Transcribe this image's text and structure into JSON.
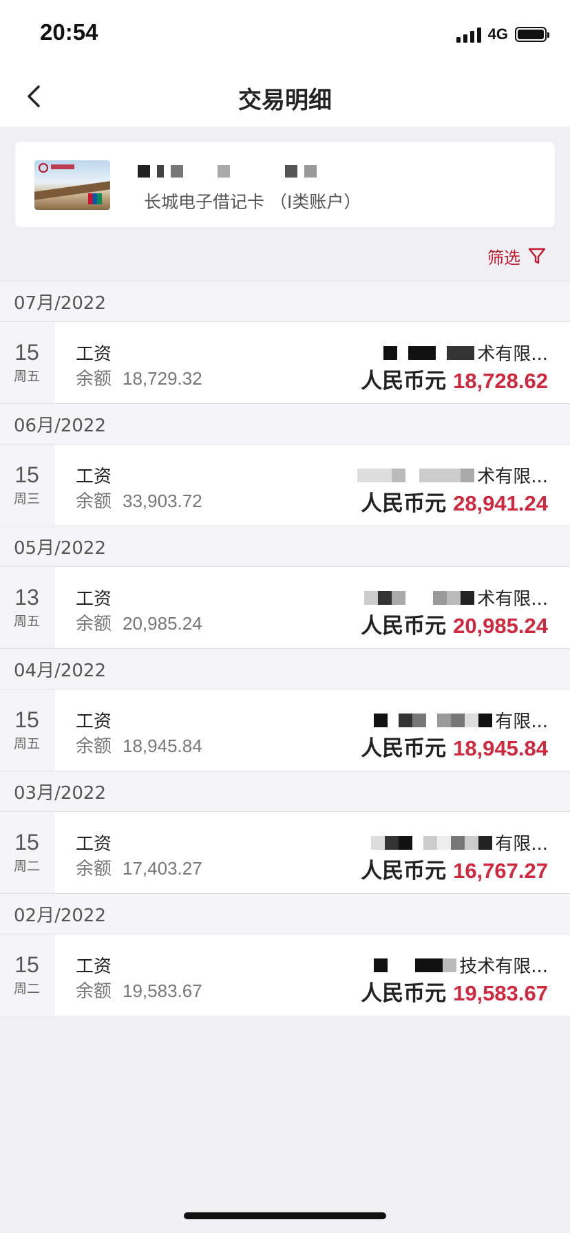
{
  "status_bar": {
    "time": "20:54",
    "network": "4G"
  },
  "nav": {
    "title": "交易明细"
  },
  "account": {
    "card_name": "长城电子借记卡 （I类账户）"
  },
  "filter": {
    "label": "筛选"
  },
  "colors": {
    "accent_red": "#d0293f",
    "filter_red": "#c5192d"
  },
  "groups": [
    {
      "month": "07月/2022",
      "tx": {
        "day": "15",
        "weekday": "周五",
        "type": "工资",
        "balance_label": "余额",
        "balance": "18,729.32",
        "counterparty": "术有限...",
        "currency": "人民币元",
        "amount": "18,728.62"
      }
    },
    {
      "month": "06月/2022",
      "tx": {
        "day": "15",
        "weekday": "周三",
        "type": "工资",
        "balance_label": "余额",
        "balance": "33,903.72",
        "counterparty": "术有限...",
        "currency": "人民币元",
        "amount": "28,941.24"
      }
    },
    {
      "month": "05月/2022",
      "tx": {
        "day": "13",
        "weekday": "周五",
        "type": "工资",
        "balance_label": "余额",
        "balance": "20,985.24",
        "counterparty": "术有限...",
        "currency": "人民币元",
        "amount": "20,985.24"
      }
    },
    {
      "month": "04月/2022",
      "tx": {
        "day": "15",
        "weekday": "周五",
        "type": "工资",
        "balance_label": "余额",
        "balance": "18,945.84",
        "counterparty": "有限...",
        "currency": "人民币元",
        "amount": "18,945.84"
      }
    },
    {
      "month": "03月/2022",
      "tx": {
        "day": "15",
        "weekday": "周二",
        "type": "工资",
        "balance_label": "余额",
        "balance": "17,403.27",
        "counterparty": "有限...",
        "currency": "人民币元",
        "amount": "16,767.27"
      }
    },
    {
      "month": "02月/2022",
      "tx": {
        "day": "15",
        "weekday": "周二",
        "type": "工资",
        "balance_label": "余额",
        "balance": "19,583.67",
        "counterparty": "技术有限...",
        "currency": "人民币元",
        "amount": "19,583.67"
      }
    }
  ]
}
